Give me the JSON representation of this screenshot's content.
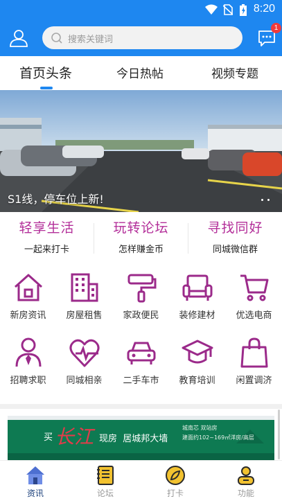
{
  "status_bar": {
    "time": "8:20"
  },
  "header": {
    "search_placeholder": "搜索关键词",
    "message_badge": "1"
  },
  "tabs": [
    {
      "label": "首页头条",
      "active": true
    },
    {
      "label": "今日热帖",
      "active": false
    },
    {
      "label": "视频专题",
      "active": false
    }
  ],
  "banner": {
    "caption": "S1线，停车位上新!"
  },
  "features": [
    {
      "title": "轻享生活",
      "subtitle": "一起来打卡"
    },
    {
      "title": "玩转论坛",
      "subtitle": "怎样赚金币"
    },
    {
      "title": "寻找同好",
      "subtitle": "同城微信群"
    }
  ],
  "grid": [
    {
      "label": "新房资讯",
      "icon": "house-icon"
    },
    {
      "label": "房屋租售",
      "icon": "building-icon"
    },
    {
      "label": "家政便民",
      "icon": "paint-roller-icon"
    },
    {
      "label": "装修建材",
      "icon": "sofa-icon"
    },
    {
      "label": "优选电商",
      "icon": "cart-icon"
    },
    {
      "label": "招聘求职",
      "icon": "person-tie-icon"
    },
    {
      "label": "同城相亲",
      "icon": "heart-pulse-icon"
    },
    {
      "label": "二手车市",
      "icon": "car-icon"
    },
    {
      "label": "教育培训",
      "icon": "graduation-cap-icon"
    },
    {
      "label": "闲置调济",
      "icon": "bag-icon"
    }
  ],
  "ad": {
    "headline_left": "买",
    "headline_brush": "长江",
    "headline_right": "现房  居城邦大墙",
    "sub1": "城南芯  双站房",
    "sub2": "建面约102~169㎡洋房/高层"
  },
  "bottom_nav": [
    {
      "label": "资讯",
      "active": true
    },
    {
      "label": "论坛",
      "active": false
    },
    {
      "label": "打卡",
      "active": false
    },
    {
      "label": "功能",
      "active": false
    }
  ],
  "colors": {
    "primary": "#1e87f0",
    "accent": "#b32e99",
    "nav_active": "#1a3f7a"
  }
}
